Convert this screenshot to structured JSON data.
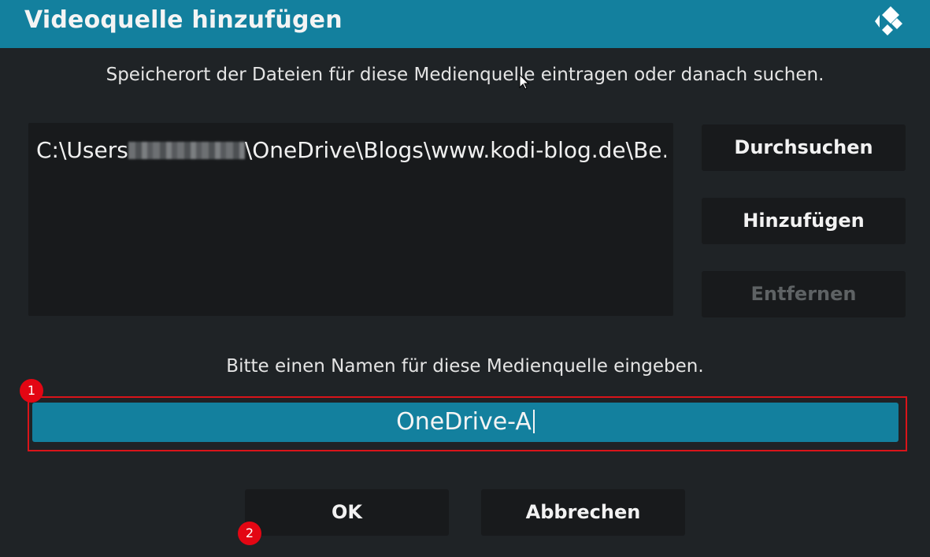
{
  "dialog": {
    "title": "Videoquelle hinzufügen",
    "logo_icon": "kodi-logo-icon",
    "path_instruction": "Speicherort der Dateien für diese Medienquelle eintragen oder danach suchen.",
    "paths": [
      {
        "prefix": "C:\\Users",
        "redacted_icon": "blurred-username",
        "suffix": "\\OneDrive\\Blogs\\www.kodi-blog.de\\Be..."
      }
    ],
    "browse_label": "Durchsuchen",
    "add_label": "Hinzufügen",
    "remove_label": "Entfernen",
    "name_instruction": "Bitte einen Namen für diese Medienquelle eingeben.",
    "name_value": "OneDrive-A",
    "ok_label": "OK",
    "cancel_label": "Abbrechen"
  },
  "annotations": {
    "marker_1": "1",
    "marker_2": "2"
  },
  "colors": {
    "accent": "#13809e",
    "background": "#1f2326",
    "panel": "#181a1c",
    "highlight": "#d9141a",
    "marker": "#e30613",
    "disabled_text": "#5e6264"
  }
}
